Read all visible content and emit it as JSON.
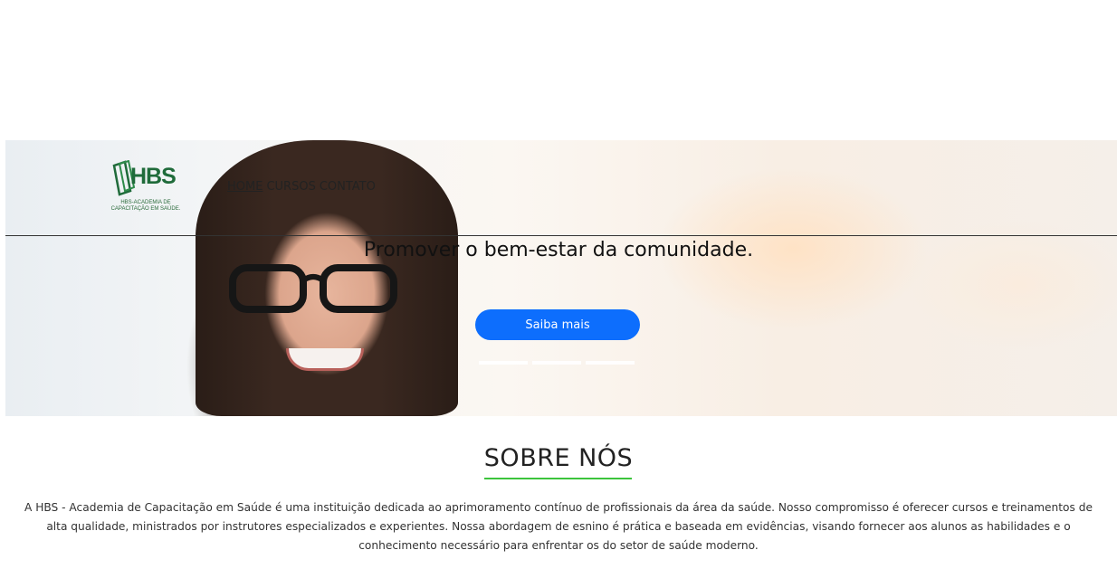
{
  "header": {
    "logo": {
      "brand": "HBS",
      "subtitle": "HBS-ACADEMIA DE CAPACITAÇÃO EM SAÚDE."
    },
    "nav": [
      {
        "label": "HOME",
        "active": true
      },
      {
        "label": "CURSOS",
        "active": false
      },
      {
        "label": "CONTATO",
        "active": false
      }
    ]
  },
  "hero": {
    "headline": "Promover o bem-estar da comunidade.",
    "cta_label": "Saiba mais",
    "slides": 3,
    "active_slide": 1
  },
  "about": {
    "title": "SOBRE NÓS",
    "text": "A HBS - Academia de Capacitação em Saúde é uma instituição dedicada ao aprimoramento contínuo de profissionais da área da saúde. Nosso compromisso é oferecer cursos e treinamentos de alta qualidade, ministrados por instrutores especializados e experientes. Nossa abordagem de esnino é prática e baseada em evidências, visando fornecer aos alunos as habilidades e o conhecimento necessário para enfrentar os do setor de saúde moderno."
  },
  "colors": {
    "primary": "#0d6efd",
    "accent": "#3cc43c",
    "brand_green": "#1f6b3a"
  }
}
